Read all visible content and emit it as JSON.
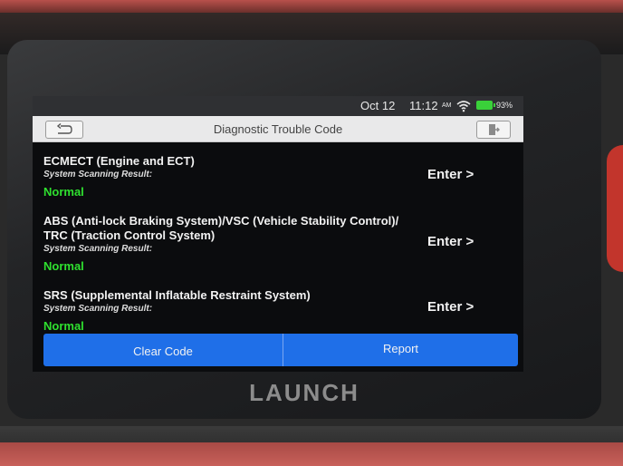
{
  "status_bar": {
    "date": "Oct 12",
    "time": "11:12",
    "ampm": "AM",
    "battery": "93%",
    "wifi_icon": "wifi-icon",
    "battery_icon": "battery-icon"
  },
  "header": {
    "title": "Diagnostic Trouble Code",
    "back_icon": "back-arrow-icon",
    "exit_icon": "exit-icon"
  },
  "systems": [
    {
      "name": "ECMECT (Engine and ECT)",
      "label": "System Scanning Result:",
      "status": "Normal",
      "action": "Enter >"
    },
    {
      "name": "ABS (Anti-lock Braking System)/VSC (Vehicle Stability Control)/ TRC (Traction Control System)",
      "label": "System Scanning Result:",
      "status": "Normal",
      "action": "Enter >"
    },
    {
      "name": "SRS (Supplemental Inflatable Restraint System)",
      "label": "System Scanning Result:",
      "status": "Normal",
      "action": "Enter >"
    }
  ],
  "buttons": {
    "clear_code": "Clear Code",
    "report": "Report"
  },
  "device": {
    "brand": "LAUNCH"
  },
  "colors": {
    "status_normal": "#2fe02f",
    "button_blue": "#1f6fe8",
    "screen_bg": "#0b0c0e"
  }
}
